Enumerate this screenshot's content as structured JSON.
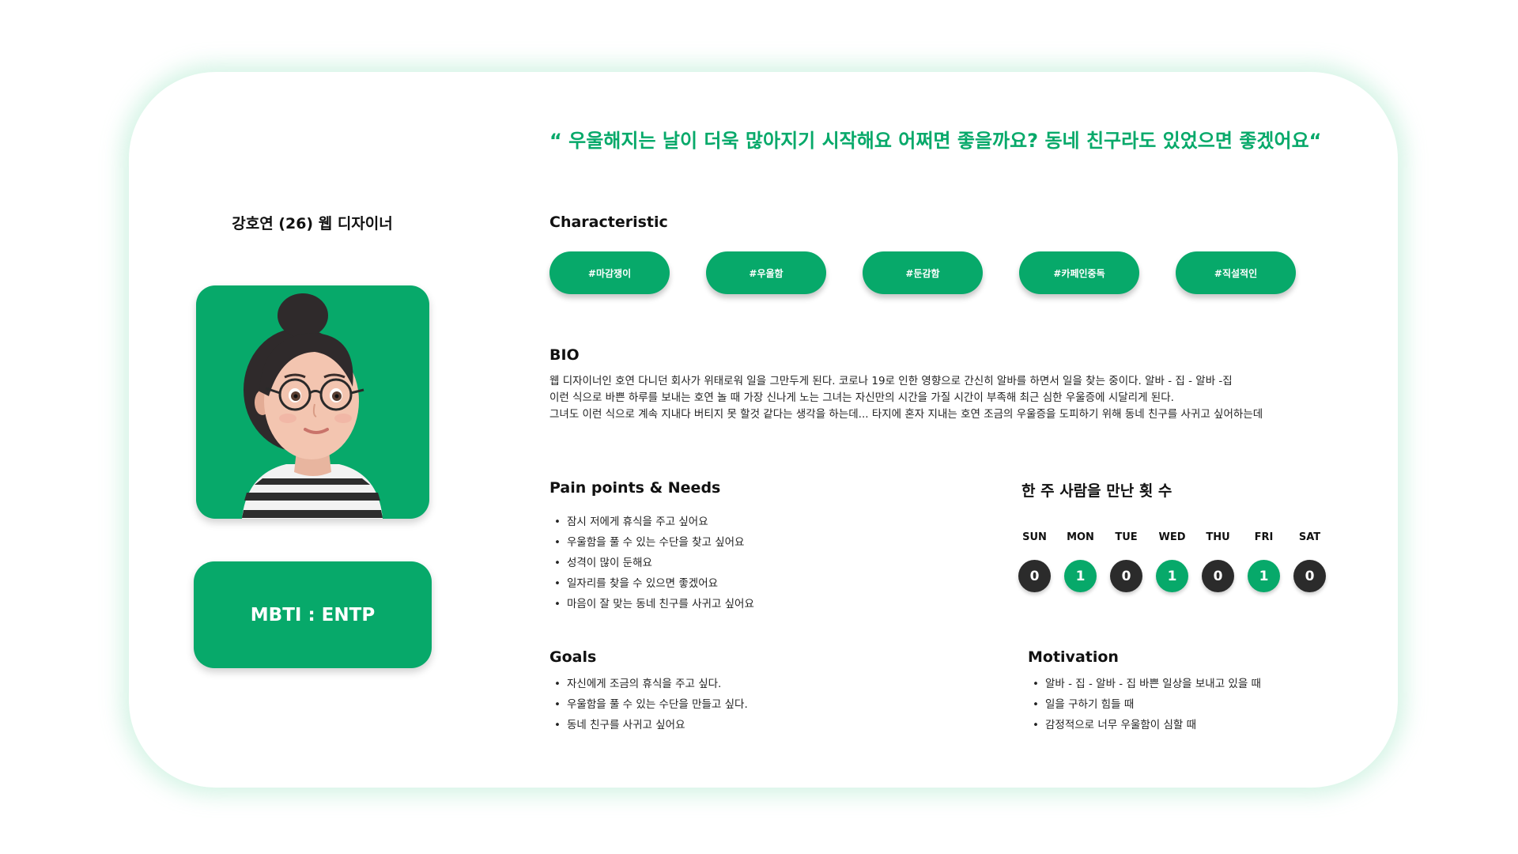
{
  "quote": "“ 우울해지는 날이 더욱 많아지기 시작해요 어쩌면 좋을까요? 동네 친구라도 있었으면 좋겠어요“",
  "profile": {
    "name": "강호연 (26) 웹 디자이너",
    "mbti": "MBTI : ENTP"
  },
  "characteristic": {
    "title": "Characteristic",
    "tags": [
      "#마감쟁이",
      "#우울함",
      "#둔감함",
      "#카페인중독",
      "#직설적인"
    ]
  },
  "bio": {
    "title": "BIO",
    "lines": [
      "웹 디자이너인 호연 다니던 회사가 위태로워 일을 그만두게 된다. 코로나 19로 인한 영향으로 간신히 알바를 하면서 일을 찾는 중이다. 알바 - 집 - 알바 -집",
      "이런 식으로 바쁜 하루를 보내는 호연 놀 때 가장 신나게 노는 그녀는 자신만의 시간을 가질 시간이 부족해 최근 심한 우울증에 시달리게 된다.",
      "그녀도 이런 식으로 계속 지내다 버티지 못 할것 같다는 생각을 하는데... 타지에 혼자 지내는 호연 조금의 우울증을 도피하기 위해 동네 친구를 사귀고 싶어하는데"
    ]
  },
  "pain_points": {
    "title": "Pain points & Needs",
    "items": [
      "잠시 저에게 휴식을 주고 싶어요",
      "우울함을 풀 수 있는 수단을 찾고 싶어요",
      "성격이 많이 둔해요",
      "일자리를 찾을 수 있으면 좋겠어요",
      "마음이 잘 맞는 동네 친구를 사귀고 싶어요"
    ]
  },
  "weekly": {
    "title": "한 주 사람을 만난 횟 수",
    "days": [
      {
        "label": "SUN",
        "count": "0",
        "highlight": false
      },
      {
        "label": "MON",
        "count": "1",
        "highlight": true
      },
      {
        "label": "TUE",
        "count": "0",
        "highlight": false
      },
      {
        "label": "WED",
        "count": "1",
        "highlight": true
      },
      {
        "label": "THU",
        "count": "0",
        "highlight": false
      },
      {
        "label": "FRI",
        "count": "1",
        "highlight": true
      },
      {
        "label": "SAT",
        "count": "0",
        "highlight": false
      }
    ]
  },
  "goals": {
    "title": "Goals",
    "items": [
      "자신에게 조금의 휴식을 주고 싶다.",
      "우울함을 풀 수 있는 수단을 만들고 싶다.",
      "동네 친구를 사귀고 싶어요"
    ]
  },
  "motivation": {
    "title": "Motivation",
    "items": [
      "알바 - 집 - 알바 - 집 바쁜 일상을 보내고 있을 때",
      "일을 구하기 힘들 때",
      "감정적으로 너무 우울함이 심할 때"
    ]
  },
  "colors": {
    "accent": "#07a96a",
    "dark_circle": "#2b2b2b"
  },
  "icons": {
    "avatar": "woman-with-glasses-avatar"
  }
}
